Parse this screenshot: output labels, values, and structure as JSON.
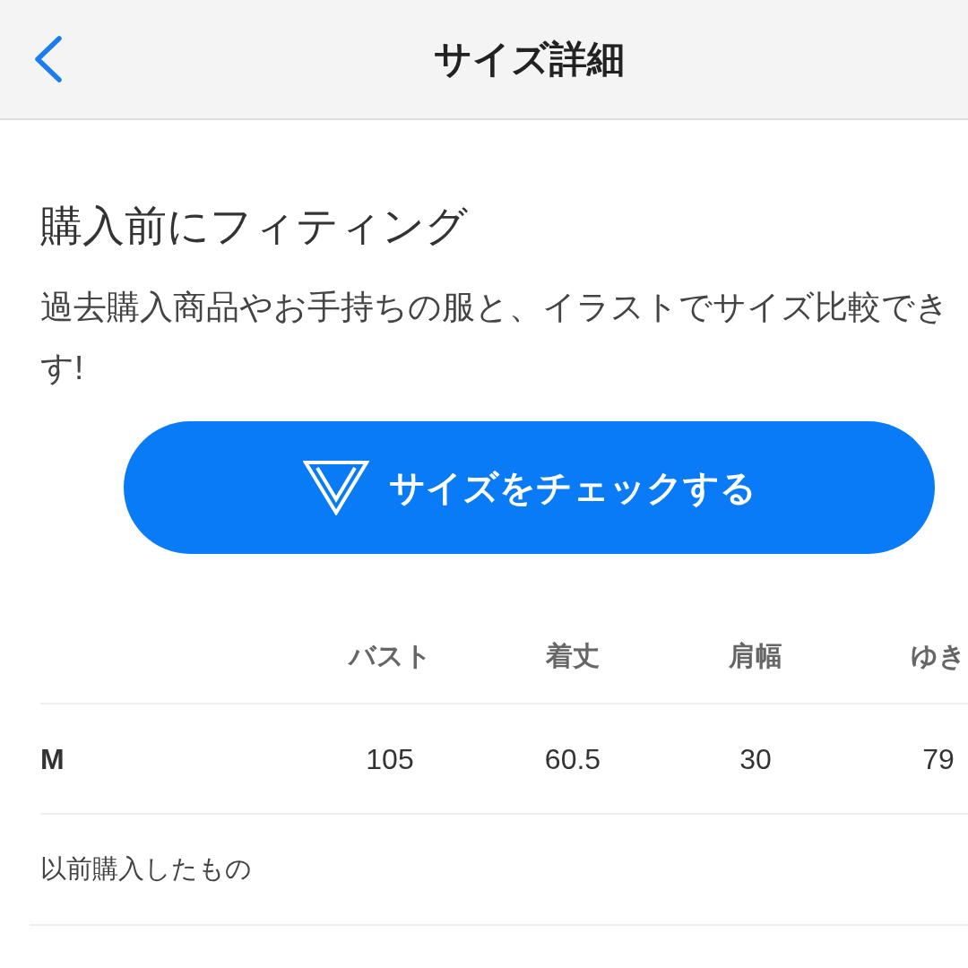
{
  "header": {
    "title": "サイズ詳細"
  },
  "fitting": {
    "heading": "購入前にフィティング",
    "description_lines": [
      "過去購入商品やお手持ちの服と、イラストでサイズ比較でき",
      "す!"
    ],
    "button": {
      "label": "サイズをチェックする"
    }
  },
  "size_table": {
    "columns": [
      "バスト",
      "着丈",
      "肩幅",
      "ゆき"
    ],
    "rows": [
      {
        "size": "M",
        "values": [
          "105",
          "60.5",
          "30",
          "79"
        ]
      }
    ],
    "section_label": "以前購入したもの"
  }
}
